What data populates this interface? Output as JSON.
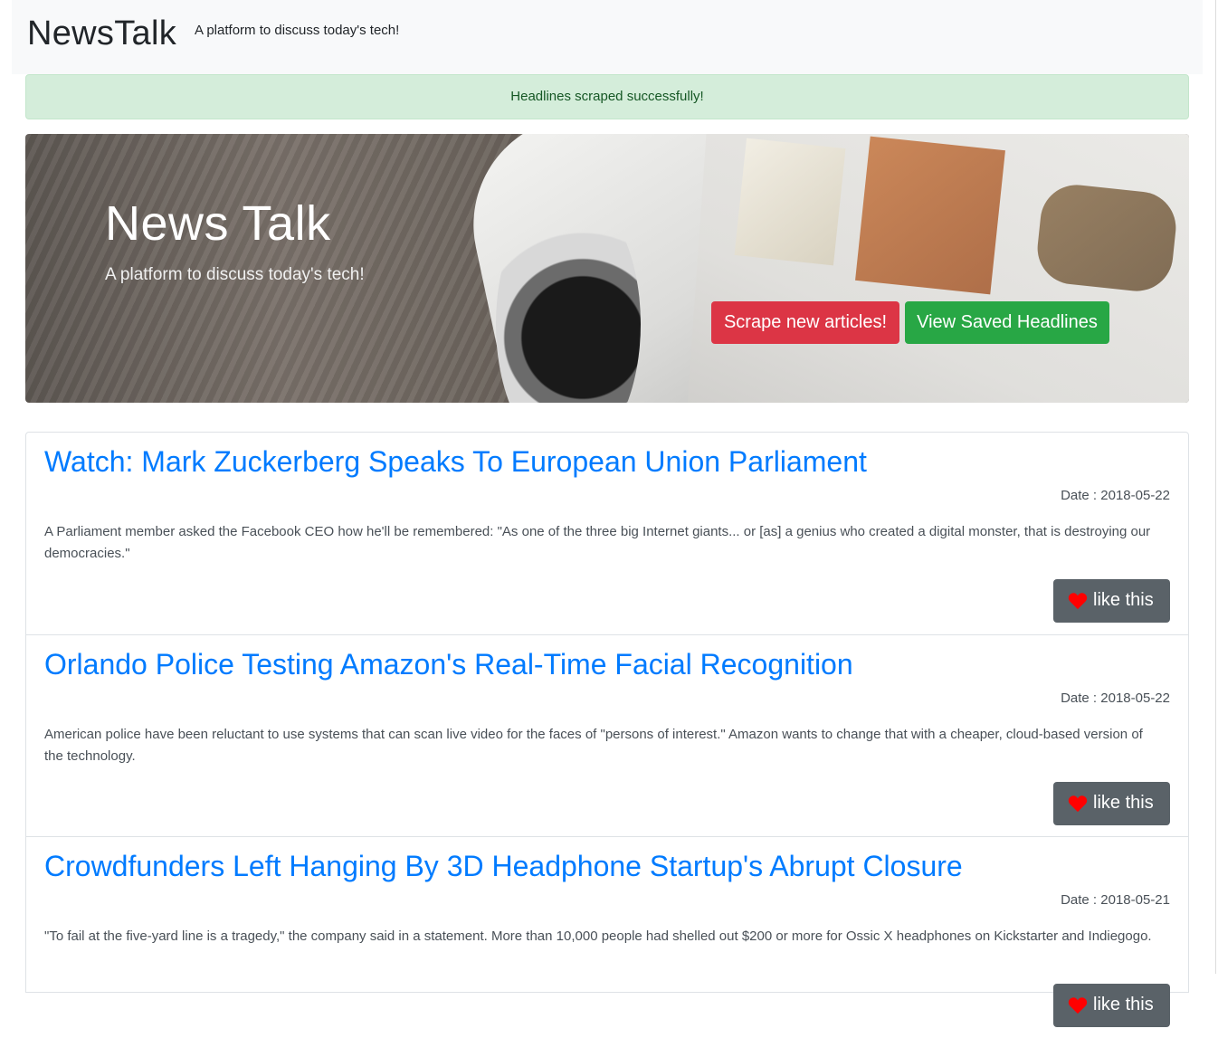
{
  "navbar": {
    "brand": "NewsTalk",
    "tagline": "A platform to discuss today's tech!"
  },
  "alert": {
    "message": "Headlines scraped successfully!"
  },
  "jumbotron": {
    "title": "News Talk",
    "subtitle": "A platform to discuss today's tech!",
    "scrape_button": "Scrape new articles!",
    "saved_button": "View Saved Headlines"
  },
  "articles": [
    {
      "title": "Watch: Mark Zuckerberg Speaks To European Union Parliament",
      "date": "Date : 2018-05-22",
      "summary": "A Parliament member asked the Facebook CEO how he'll be remembered: \"As one of the three big Internet giants... or [as] a genius who created a digital monster, that is destroying our democracies.\"",
      "like_label": "like this"
    },
    {
      "title": "Orlando Police Testing Amazon's Real-Time Facial Recognition",
      "date": "Date : 2018-05-22",
      "summary": "American police have been reluctant to use systems that can scan live video for the faces of \"persons of interest.\" Amazon wants to change that with a cheaper, cloud-based version of the technology.",
      "like_label": "like this"
    },
    {
      "title": "Crowdfunders Left Hanging By 3D Headphone Startup's Abrupt Closure",
      "date": "Date : 2018-05-21",
      "summary": "\"To fail at the five-yard line is a tragedy,\" the company said in a statement. More than 10,000 people had shelled out $200 or more for Ossic X headphones on Kickstarter and Indiegogo.",
      "like_label": "like this"
    }
  ],
  "colors": {
    "link": "#007bff",
    "danger": "#dc3545",
    "success": "#28a745",
    "alert_bg": "#d4edda",
    "like_button": "#5a6268",
    "heart": "#ff0000"
  },
  "icons": {
    "like": "heart-icon"
  }
}
